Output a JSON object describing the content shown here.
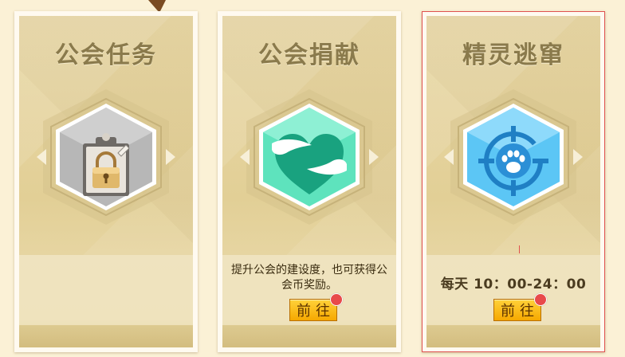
{
  "cards": [
    {
      "title": "公会任务",
      "icon": "padlock-clipboard-icon",
      "tile_color": "#b9b9b9",
      "locked": true
    },
    {
      "title": "公会捐献",
      "icon": "heart-hands-icon",
      "tile_color": "#5ee3bd",
      "description": "提升公会的建设度，也可获得公会币奖励。",
      "button_label": "前往",
      "has_notification": true
    },
    {
      "title": "精灵逃窜",
      "icon": "paw-crosshair-icon",
      "tile_color": "#5cc6f5",
      "schedule": "每天 10：00-24：00",
      "button_label": "前往",
      "has_notification": true,
      "selected": true
    }
  ]
}
